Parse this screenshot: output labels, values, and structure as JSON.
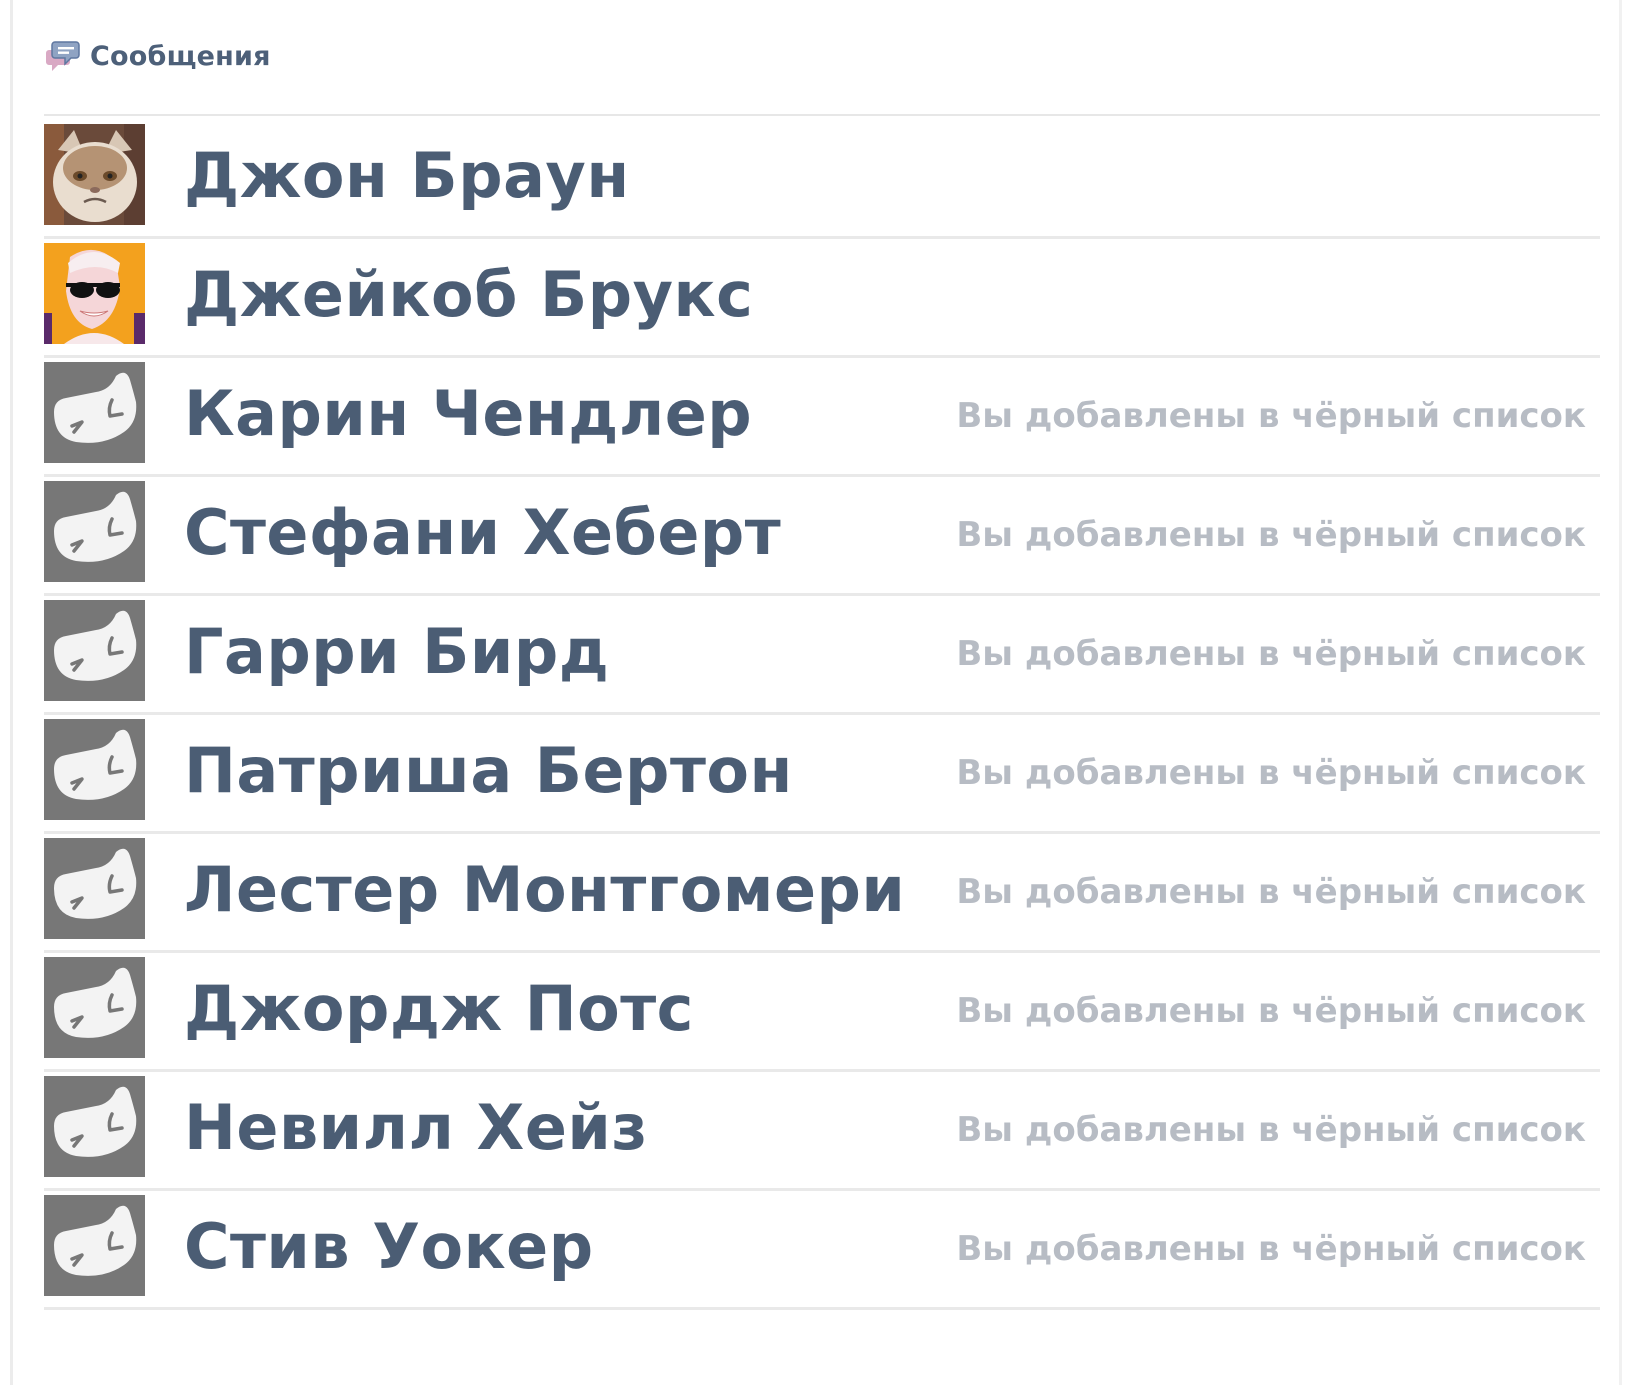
{
  "header": {
    "title": "Сообщения",
    "icon": "messages-icon"
  },
  "colors": {
    "name_text": "#4b5d74",
    "status_text": "#b7bcc4",
    "header_text": "#4d6079",
    "placeholder_avatar_bg": "#777777",
    "divider": "#e9e9e9"
  },
  "conversations": [
    {
      "name": "Джон Браун",
      "status": "",
      "avatar": "grumpy-cat-photo"
    },
    {
      "name": "Джейкоб Брукс",
      "status": "",
      "avatar": "sunglasses-man-illustration"
    },
    {
      "name": "Карин Чендлер",
      "status": "Вы добавлены в чёрный список",
      "avatar": "blocked-placeholder-icon"
    },
    {
      "name": "Стефани Хеберт",
      "status": "Вы добавлены в чёрный список",
      "avatar": "blocked-placeholder-icon"
    },
    {
      "name": "Гарри Бирд",
      "status": "Вы добавлены в чёрный список",
      "avatar": "blocked-placeholder-icon"
    },
    {
      "name": "Патриша Бертон",
      "status": "Вы добавлены в чёрный список",
      "avatar": "blocked-placeholder-icon"
    },
    {
      "name": "Лестер Монтгомери",
      "status": "Вы добавлены в чёрный список",
      "avatar": "blocked-placeholder-icon"
    },
    {
      "name": "Джордж Потс",
      "status": "Вы добавлены в чёрный список",
      "avatar": "blocked-placeholder-icon"
    },
    {
      "name": "Невилл Хейз",
      "status": "Вы добавлены в чёрный список",
      "avatar": "blocked-placeholder-icon"
    },
    {
      "name": "Стив Уокер",
      "status": "Вы добавлены в чёрный список",
      "avatar": "blocked-placeholder-icon"
    }
  ]
}
